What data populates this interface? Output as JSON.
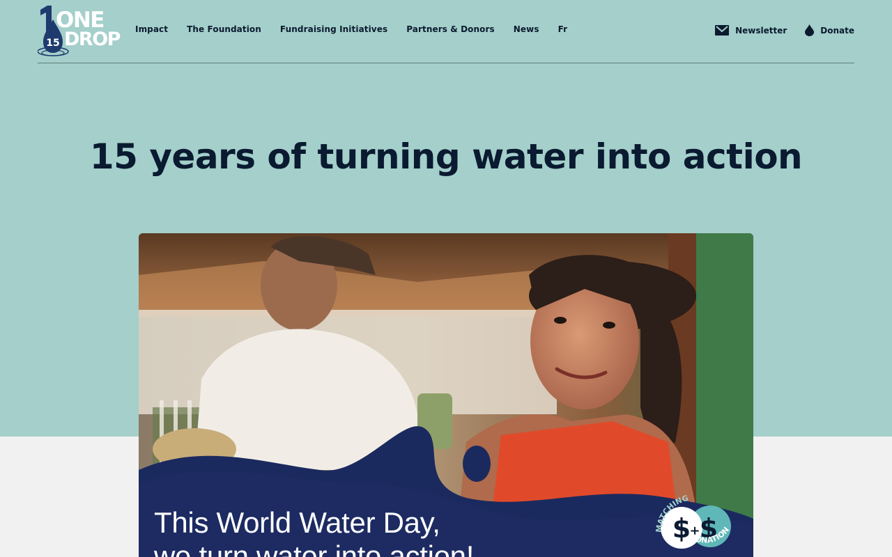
{
  "brand": {
    "logo_text_line1": "ONE",
    "logo_text_line2": "DROP",
    "logo_badge": "15",
    "color_primary": "#1e3a6e",
    "color_hero_bg": "#a4cfcb"
  },
  "nav": {
    "items": [
      {
        "label": "Impact"
      },
      {
        "label": "The Foundation"
      },
      {
        "label": "Fundraising Initiatives"
      },
      {
        "label": "Partners & Donors"
      },
      {
        "label": "News"
      },
      {
        "label": "Fr"
      }
    ]
  },
  "utility": {
    "newsletter_label": "Newsletter",
    "newsletter_icon": "envelope-icon",
    "donate_label": "Donate",
    "donate_icon": "water-drop-icon"
  },
  "hero": {
    "title": "15 years of turning water into action",
    "banner_line1": "This World Water Day,",
    "banner_line2": "we turn water into action!",
    "badge_top": "MATCHING",
    "badge_bottom": "DONATION",
    "badge_symbol_left": "$",
    "badge_plus": "+",
    "badge_symbol_right": "$"
  }
}
